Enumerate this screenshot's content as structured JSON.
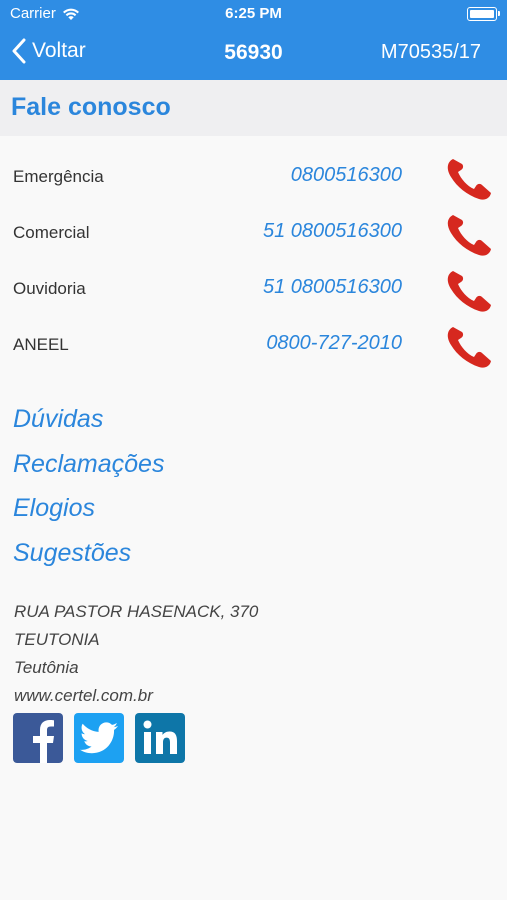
{
  "status_bar": {
    "carrier": "Carrier",
    "time": "6:25 PM",
    "icons": [
      "wifi-icon",
      "battery-icon"
    ]
  },
  "nav": {
    "back_label": "Voltar",
    "title": "56930",
    "right_text": "M70535/17"
  },
  "section_title": "Fale conosco",
  "contacts": [
    {
      "label": "Emergência",
      "number": "0800516300"
    },
    {
      "label": "Comercial",
      "number": "51 0800516300"
    },
    {
      "label": "Ouvidoria",
      "number": "51 0800516300"
    },
    {
      "label": "ANEEL",
      "number": "0800-727-2010"
    }
  ],
  "links": [
    "Dúvidas",
    "Reclamações",
    "Elogios",
    "Sugestões"
  ],
  "address": {
    "street": "RUA PASTOR HASENACK, 370",
    "district": "TEUTONIA",
    "city": "Teutônia",
    "website": "www.certel.com.br"
  },
  "social": [
    "facebook-icon",
    "twitter-icon",
    "linkedin-icon"
  ],
  "colors": {
    "accent": "#2f8de4",
    "link": "#2b86dc",
    "phone_red": "#d6281f",
    "facebook": "#3b5998",
    "twitter": "#1da1f2",
    "linkedin": "#0e76a8"
  }
}
